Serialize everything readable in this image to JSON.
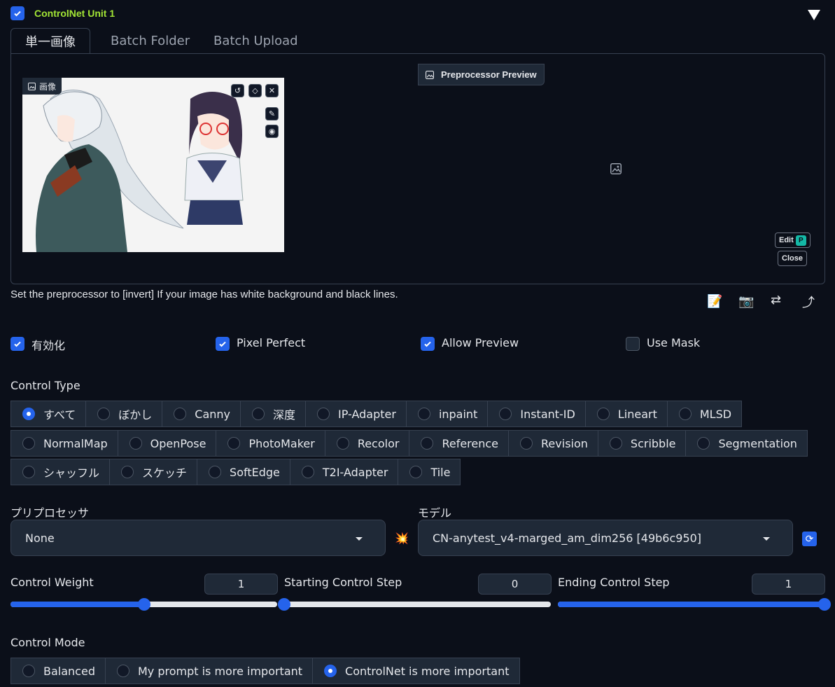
{
  "unit": {
    "title": "ControlNet Unit 1",
    "enabled": true
  },
  "tabs": [
    {
      "label": "単一画像",
      "active": true
    },
    {
      "label": "Batch Folder"
    },
    {
      "label": "Batch Upload"
    }
  ],
  "image_panel": {
    "label": "画像"
  },
  "preview_panel": {
    "label": "Preprocessor Preview",
    "edit_label": "Edit",
    "close_label": "Close"
  },
  "hint": "Set the preprocessor to [invert] If your image has white background and black lines.",
  "options": [
    {
      "label": "有効化",
      "checked": true
    },
    {
      "label": "Pixel Perfect",
      "checked": true
    },
    {
      "label": "Allow Preview",
      "checked": true
    },
    {
      "label": "Use Mask",
      "checked": false
    }
  ],
  "control_type": {
    "label": "Control Type",
    "selected": "すべて",
    "rows": [
      [
        "すべて",
        "ぼかし",
        "Canny",
        "深度",
        "IP-Adapter",
        "inpaint",
        "Instant-ID",
        "Lineart",
        "MLSD"
      ],
      [
        "NormalMap",
        "OpenPose",
        "PhotoMaker",
        "Recolor",
        "Reference",
        "Revision",
        "Scribble",
        "Segmentation"
      ],
      [
        "シャッフル",
        "スケッチ",
        "SoftEdge",
        "T2I-Adapter",
        "Tile"
      ]
    ]
  },
  "preprocessor": {
    "label": "プリプロセッサ",
    "value": "None"
  },
  "model": {
    "label": "モデル",
    "value": "CN-anytest_v4-marged_am_dim256 [49b6c950]"
  },
  "sliders": [
    {
      "label": "Control Weight",
      "value": "1",
      "fraction": 0.5
    },
    {
      "label": "Starting Control Step",
      "value": "0",
      "fraction": 0.0
    },
    {
      "label": "Ending Control Step",
      "value": "1",
      "fraction": 1.0
    }
  ],
  "control_mode": {
    "label": "Control Mode",
    "options": [
      "Balanced",
      "My prompt is more important",
      "ControlNet is more important"
    ],
    "selected": "ControlNet is more important"
  },
  "colors": {
    "accent": "#2563eb",
    "title_green": "#a3e635",
    "background": "#0b0f19"
  }
}
